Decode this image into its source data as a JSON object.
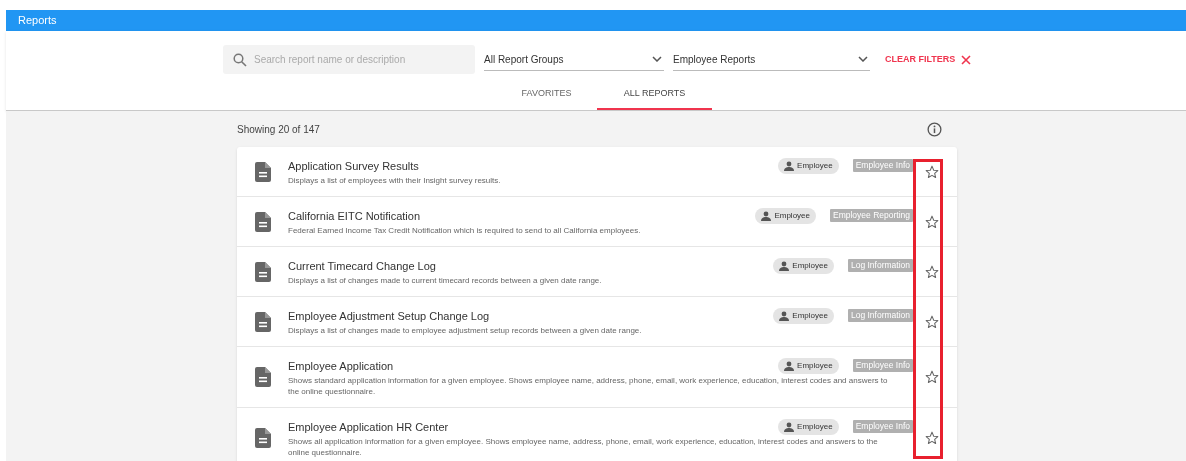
{
  "header": {
    "title": "Reports"
  },
  "filters": {
    "search": {
      "placeholder": "Search report name or description"
    },
    "group_select": {
      "value": "All Report Groups"
    },
    "type_select": {
      "value": "Employee Reports"
    },
    "clear_button": {
      "label": "CLEAR FILTERS"
    }
  },
  "tabs": [
    {
      "label": "FAVORITES",
      "selected": false
    },
    {
      "label": "ALL REPORTS",
      "selected": true
    }
  ],
  "summary": "Showing 20 of 147",
  "reports": [
    {
      "title": "Application Survey Results",
      "description": "Displays a list of employees with their Insight survey results.",
      "scope": "Employee",
      "category": "Employee Info",
      "favorite": false
    },
    {
      "title": "California EITC Notification",
      "description": "Federal Earned Income Tax Credit Notification which is required to send to all California employees.",
      "scope": "Employee",
      "category": "Employee Reporting",
      "favorite": false
    },
    {
      "title": "Current Timecard Change Log",
      "description": "Displays a list of changes made to current timecard records between a given date range.",
      "scope": "Employee",
      "category": "Log Information",
      "favorite": false
    },
    {
      "title": "Employee Adjustment Setup Change Log",
      "description": "Displays a list of changes made to employee adjustment setup records between a given date range.",
      "scope": "Employee",
      "category": "Log Information",
      "favorite": false
    },
    {
      "title": "Employee Application",
      "description": "Shows standard application information for a given employee. Shows employee name, address, phone, email, work experience, education, interest codes and answers to the online questionnaire.",
      "scope": "Employee",
      "category": "Employee Info",
      "favorite": false
    },
    {
      "title": "Employee Application HR Center",
      "description": "Shows all application information for a given employee. Shows employee name, address, phone, email, work experience, education, interest codes and answers to the online questionnaire.",
      "scope": "Employee",
      "category": "Employee Info",
      "favorite": false
    }
  ]
}
